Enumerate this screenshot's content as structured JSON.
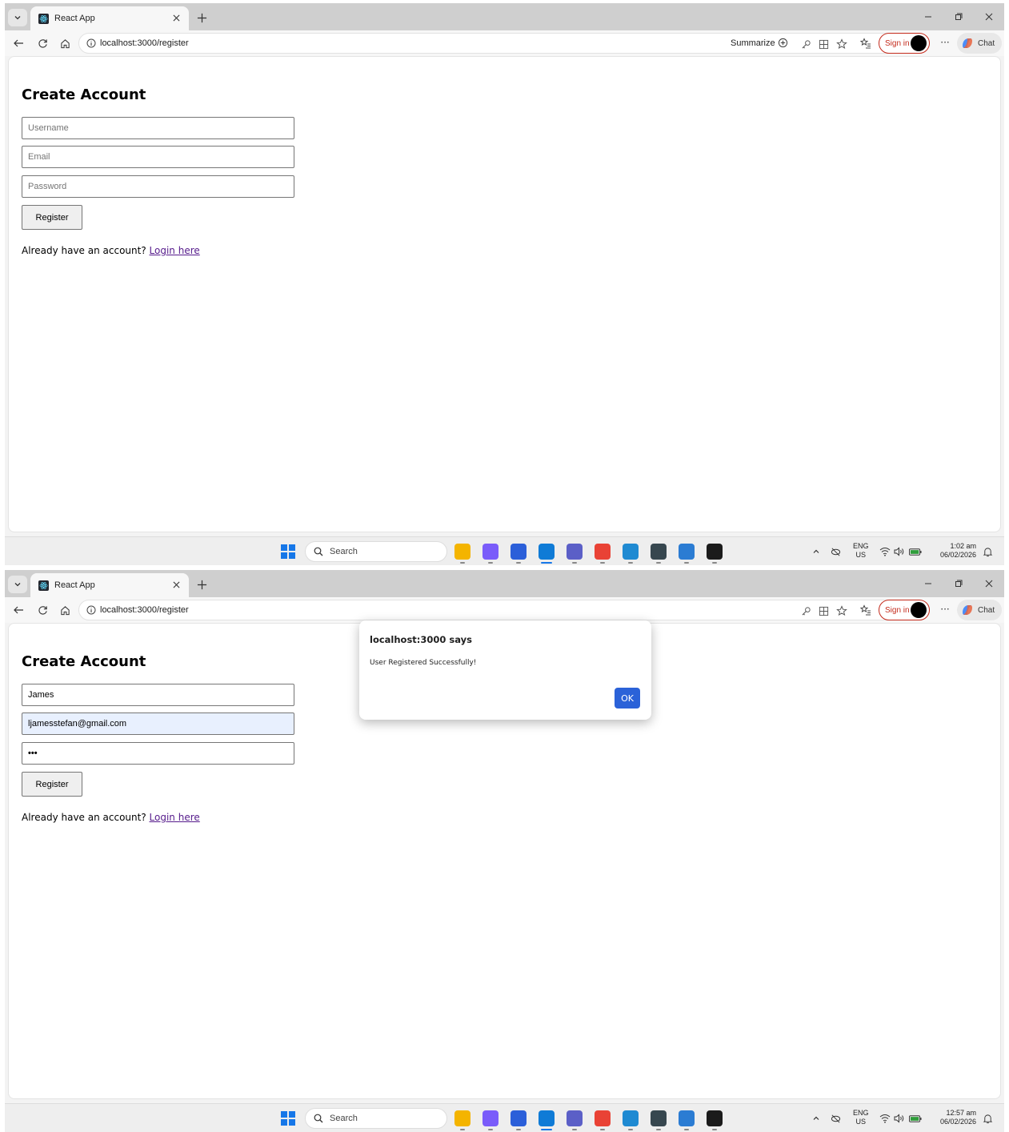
{
  "browser": {
    "tab_title": "React App",
    "url": "localhost:3000/register",
    "summarize_label": "Summarize",
    "signin_label": "Sign in",
    "more_label": "···",
    "chat_label": "Chat"
  },
  "page": {
    "title": "Create Account",
    "username_placeholder": "Username",
    "email_placeholder": "Email",
    "password_placeholder": "Password",
    "register_label": "Register",
    "login_prompt": "Already have an account?",
    "login_link": "Login here"
  },
  "shot1": {
    "clock_time": "1:02 am",
    "clock_date": "06/02/2026"
  },
  "shot2": {
    "username_value": "James",
    "email_value": "ljamesstefan@gmail.com",
    "password_value": "•••",
    "dialog_title": "localhost:3000 says",
    "dialog_message": "User Registered Successfully!",
    "dialog_ok": "OK",
    "clock_time": "12:57 am",
    "clock_date": "06/02/2026"
  },
  "taskbar": {
    "search_label": "Search",
    "lang_line1": "ENG",
    "lang_line2": "US",
    "apps": [
      "file-explorer-icon",
      "copilot-icon",
      "whiteboard-icon",
      "edge-icon",
      "teams-icon",
      "chrome-icon",
      "vscode-icon",
      "ssms-icon",
      "word-icon",
      "terminal-icon"
    ],
    "app_colors": [
      "#f4b400",
      "#7a5cfa",
      "#2b5fd9",
      "#0f7bd6",
      "#5b5fc7",
      "#e94235",
      "#1f8ad2",
      "#37474f",
      "#2b7cd3",
      "#1b1b1b"
    ]
  },
  "colors": {
    "accent": "#2b62d8",
    "signin_border": "#c42b1c",
    "autofill": "#e8f0fe",
    "visited_link": "#551a8b"
  }
}
